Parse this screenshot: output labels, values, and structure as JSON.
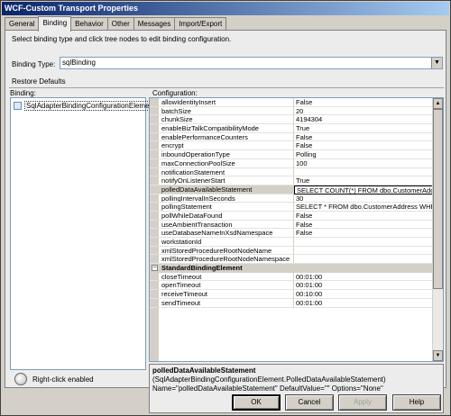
{
  "window": {
    "title": "WCF-Custom Transport Properties"
  },
  "tabs": [
    "General",
    "Binding",
    "Behavior",
    "Other",
    "Messages",
    "Import/Export"
  ],
  "hint": "Select binding type and click tree nodes to edit binding configuration.",
  "binding_type": {
    "label": "Binding Type:",
    "value": "sqlBinding"
  },
  "restore_defaults": "Restore Defaults",
  "binding_pane": {
    "label": "Binding:",
    "item": "SqlAdapterBindingConfigurationElement"
  },
  "right_click": "Right-click enabled",
  "config": {
    "label": "Configuration:",
    "rows": [
      {
        "name": "allowIdentityInsert",
        "value": "False"
      },
      {
        "name": "batchSize",
        "value": "20"
      },
      {
        "name": "chunkSize",
        "value": "4194304"
      },
      {
        "name": "enableBizTalkCompatibilityMode",
        "value": "True"
      },
      {
        "name": "enablePerformanceCounters",
        "value": "False"
      },
      {
        "name": "encrypt",
        "value": "False"
      },
      {
        "name": "inboundOperationType",
        "value": "Polling"
      },
      {
        "name": "maxConnectionPoolSize",
        "value": "100"
      },
      {
        "name": "notificationStatement",
        "value": ""
      },
      {
        "name": "notifyOnListenerStart",
        "value": "True"
      },
      {
        "name": "polledDataAvailableStatement",
        "value": "SELECT COUNT(*) FROM dbo.CustomerAddress",
        "selected": true
      },
      {
        "name": "pollingIntervalInSeconds",
        "value": "30"
      },
      {
        "name": "pollingStatement",
        "value": "SELECT * FROM dbo.CustomerAddress WHERE I"
      },
      {
        "name": "pollWhileDataFound",
        "value": "False"
      },
      {
        "name": "useAmbientTransaction",
        "value": "False"
      },
      {
        "name": "useDatabaseNameInXsdNamespace",
        "value": "False"
      },
      {
        "name": "workstationId",
        "value": ""
      },
      {
        "name": "xmlStoredProcedureRootNodeName",
        "value": ""
      },
      {
        "name": "xmlStoredProcedureRootNodeNamespace",
        "value": ""
      }
    ],
    "category": "StandardBindingElement",
    "rows2": [
      {
        "name": "closeTimeout",
        "value": "00:01:00"
      },
      {
        "name": "openTimeout",
        "value": "00:01:00"
      },
      {
        "name": "receiveTimeout",
        "value": "00:10:00"
      },
      {
        "name": "sendTimeout",
        "value": "00:01:00"
      }
    ]
  },
  "description": {
    "title": "polledDataAvailableStatement",
    "line1": "(SqlAdapterBindingConfigurationElement.PolledDataAvailableStatement)",
    "line2": "Name=\"polledDataAvailableStatement\" DefaultValue=\"\" Options=\"None\""
  },
  "buttons": {
    "ok": "OK",
    "cancel": "Cancel",
    "apply": "Apply",
    "help": "Help"
  }
}
